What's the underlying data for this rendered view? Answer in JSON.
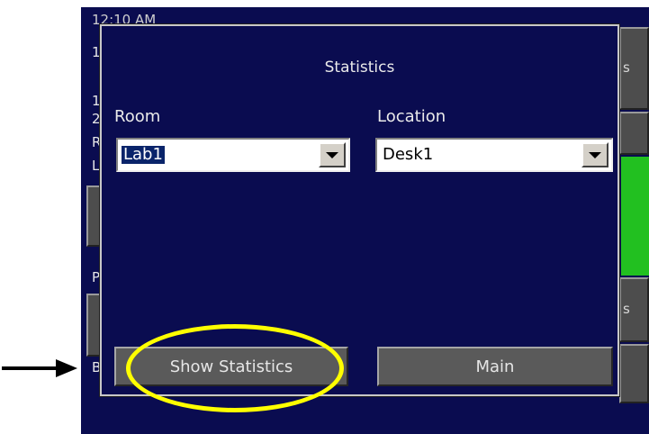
{
  "background": {
    "time_text": "12:10 AM",
    "line1": "1",
    "line2": "1",
    "line3": "2",
    "line4": "R",
    "line5": "L",
    "line6": "P",
    "line7": "B",
    "right_label_top": "s",
    "right_label_mid": "s"
  },
  "dialog": {
    "title": "Statistics",
    "room_label": "Room",
    "room_value": "Lab1",
    "location_label": "Location",
    "location_value": "Desk1",
    "show_stats_label": "Show Statistics",
    "main_label": "Main"
  },
  "colors": {
    "screen_bg": "#0a0c50",
    "highlight": "#ffff00",
    "status_green": "#22c020"
  }
}
